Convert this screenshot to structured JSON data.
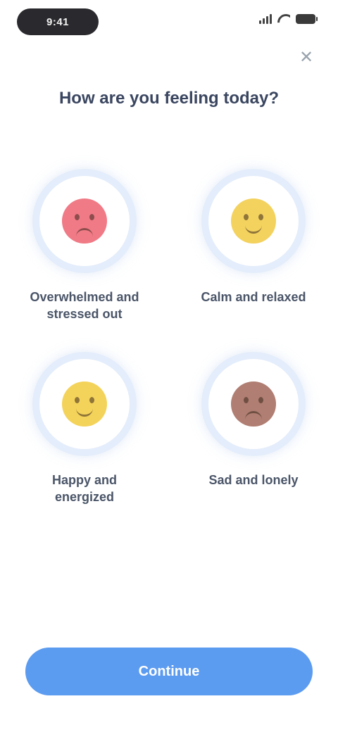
{
  "status_bar": {
    "time": "9:41"
  },
  "header": {
    "close_glyph": "✕",
    "title": "How are you feeling today?"
  },
  "options": [
    {
      "label": "Overwhelmed and stressed out",
      "emoji": "angry",
      "color": "#f07a86"
    },
    {
      "label": "Calm and relaxed",
      "emoji": "smile",
      "color": "#f3d25e"
    },
    {
      "label": "Happy and energized",
      "emoji": "grin",
      "color": "#f4d35a"
    },
    {
      "label": "Sad and lonely",
      "emoji": "sad",
      "color": "#b07e72"
    }
  ],
  "footer": {
    "cta_label": "Continue"
  },
  "colors": {
    "accent": "#5b9bf0",
    "ring": "#e4edfb"
  }
}
